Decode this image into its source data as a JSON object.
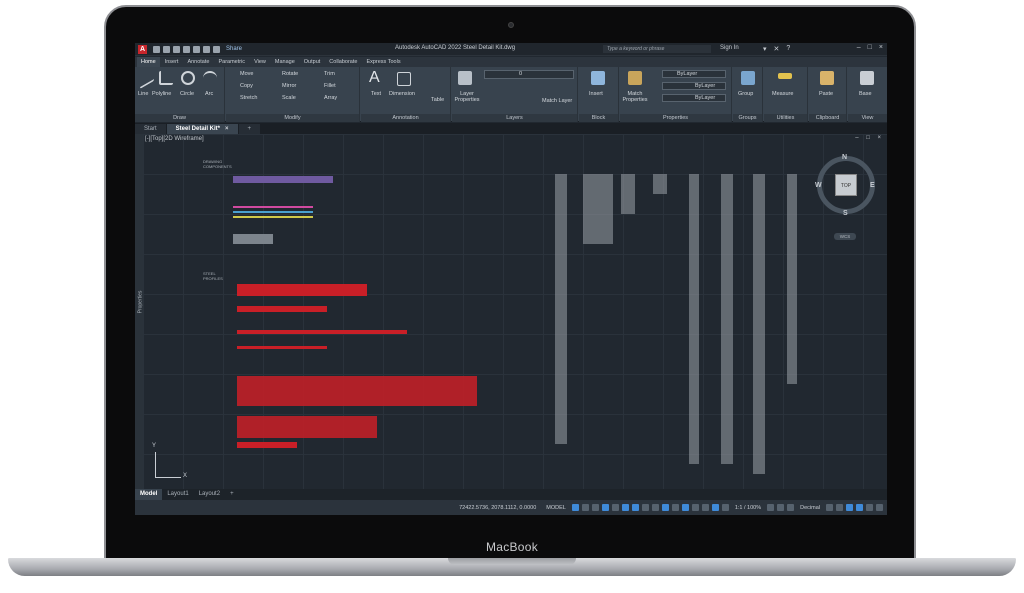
{
  "device": {
    "brand": "MacBook"
  },
  "app": {
    "title": "Autodesk AutoCAD 2022    Steel Detail Kit.dwg",
    "share_label": "Share",
    "search_placeholder": "Type a keyword or phrase",
    "sign_in": "Sign In",
    "logo": "A"
  },
  "ribbon_tabs": [
    "Home",
    "Insert",
    "Annotate",
    "Parametric",
    "View",
    "Manage",
    "Output",
    "Collaborate",
    "Express Tools"
  ],
  "panels": {
    "draw": {
      "title": "Draw",
      "line": "Line",
      "polyline": "Polyline",
      "circle": "Circle",
      "arc": "Arc"
    },
    "modify": {
      "title": "Modify",
      "move": "Move",
      "rotate": "Rotate",
      "trim": "Trim",
      "copy": "Copy",
      "mirror": "Mirror",
      "fillet": "Fillet",
      "stretch": "Stretch",
      "scale": "Scale",
      "array": "Array"
    },
    "annotation": {
      "title": "Annotation",
      "text": "Text",
      "dimension": "Dimension",
      "table": "Table"
    },
    "layers": {
      "title": "Layers",
      "layer_properties": "Layer Properties",
      "current_layer": "0",
      "match_layer": "Match Layer"
    },
    "block": {
      "title": "Block",
      "insert": "Insert"
    },
    "properties": {
      "title": "Properties",
      "match_properties": "Match Properties",
      "bylayer1": "ByLayer",
      "bylayer2": "ByLayer",
      "bylayer3": "ByLayer"
    },
    "groups": {
      "title": "Groups",
      "group": "Group"
    },
    "utilities": {
      "title": "Utilities",
      "measure": "Measure"
    },
    "clipboard": {
      "title": "Clipboard",
      "paste": "Paste"
    },
    "view": {
      "title": "View",
      "base": "Base"
    }
  },
  "doc_tabs": {
    "start": "Start",
    "active": "Steel Detail Kit*"
  },
  "viewport": {
    "label": "[-][Top][2D Wireframe]",
    "properties_label": "Properties"
  },
  "viewcube": {
    "n": "N",
    "s": "S",
    "e": "E",
    "w": "W",
    "face": "TOP",
    "wcs": "WCS"
  },
  "drawing_labels": {
    "components": "DRAWING COMPONENTS",
    "profiles": "STEEL PROFILES",
    "axis_y": "Y",
    "axis_x": "X"
  },
  "layout_tabs": [
    "Model",
    "Layout1",
    "Layout2"
  ],
  "status": {
    "coords": "72422.5736, 2078.1112, 0.0000",
    "mode": "MODEL",
    "scale": "1:1 / 100%",
    "units": "Decimal"
  },
  "colors": {
    "accent": "#3f8ad8",
    "drawing_red": "#c91f27",
    "background": "#212830"
  }
}
